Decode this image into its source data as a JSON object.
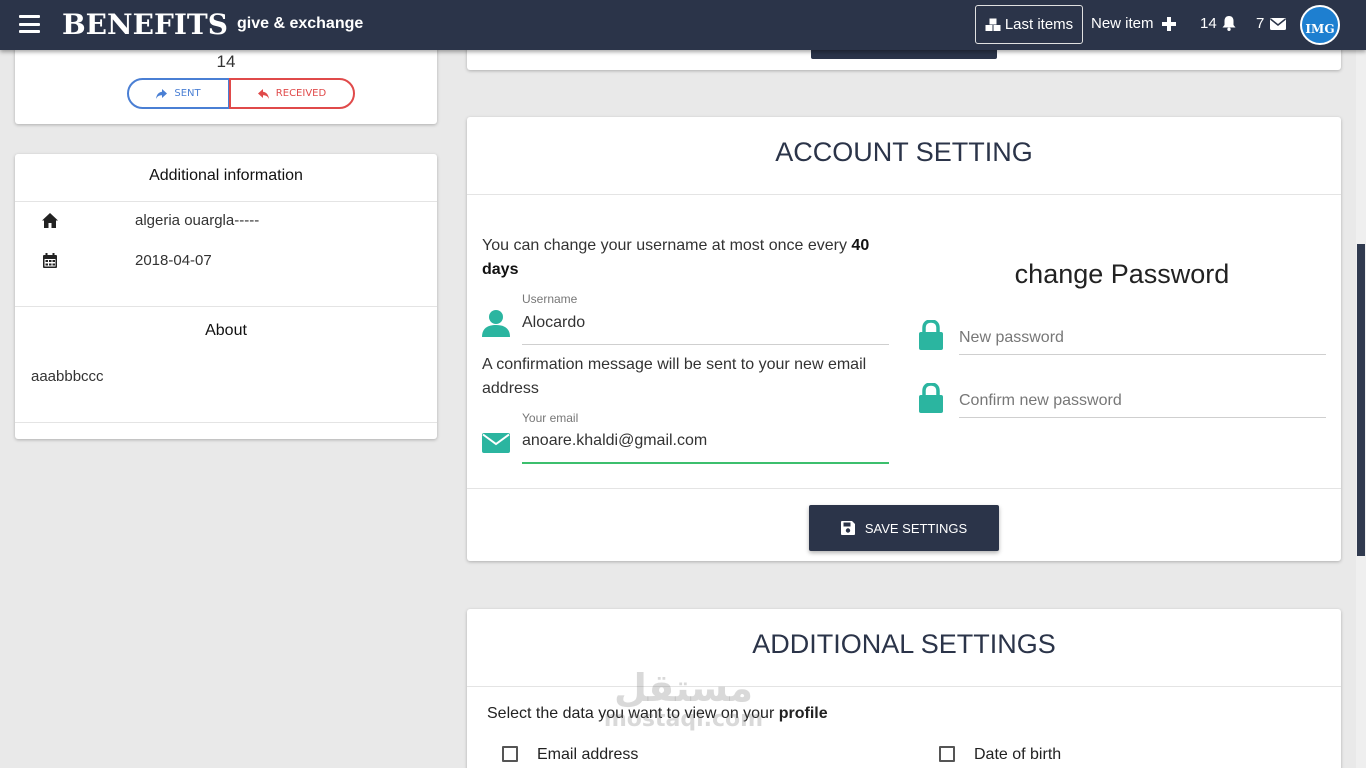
{
  "nav": {
    "logo": "BENEFITS",
    "tagline": "give & exchange",
    "last_items": "Last items",
    "new_item": "New item",
    "notifications_count": "14",
    "messages_count": "7",
    "avatar_text": "IMG"
  },
  "profile": {
    "count": "14",
    "sent_label": "SENT",
    "received_label": "RECEIVED"
  },
  "additional_info": {
    "title": "Additional information",
    "location": "algeria ouargla-----",
    "date": "2018-04-07",
    "about_title": "About",
    "about_text": "aaabbbccc"
  },
  "account": {
    "title": "ACCOUNT SETTING",
    "username_note_prefix": "You can change your username at most once every",
    "username_note_days": "40 days",
    "username_label": "Username",
    "username_value": "Alocardo",
    "email_note": "A confirmation message will be sent to your new email address",
    "email_label": "Your email",
    "email_value": "anoare.khaldi@gmail.com",
    "password_title": "change Password",
    "new_password_placeholder": "New password",
    "confirm_password_placeholder": "Confirm new password",
    "save_label": "SAVE SETTINGS"
  },
  "additional": {
    "title": "ADDITIONAL SETTINGS",
    "select_note_prefix": "Select the data you want to view on your",
    "select_note_bold": "profile",
    "options": [
      "Email address",
      "Date of birth"
    ]
  },
  "watermark": {
    "arabic": "مستقل",
    "latin": "mostaql.com"
  },
  "colors": {
    "nav_bg": "#2b3449",
    "accent_teal": "#2bb5a0",
    "sent_blue": "#4a7fd4",
    "received_red": "#e04a4a",
    "active_green": "#3cbf6d"
  }
}
